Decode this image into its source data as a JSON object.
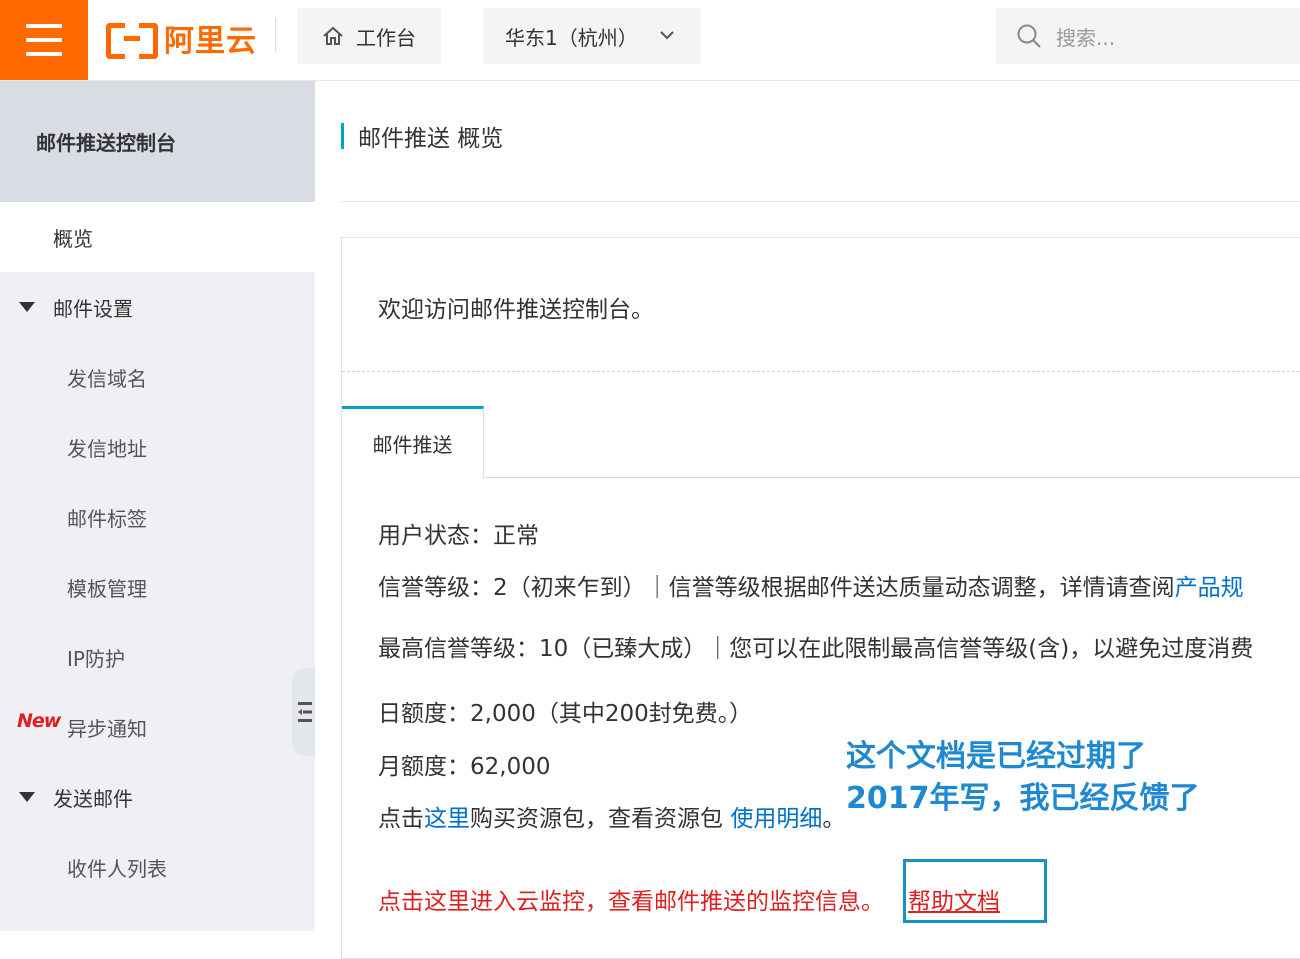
{
  "header": {
    "logo_text": "阿里云",
    "workbench_label": "工作台",
    "region_label": "华东1（杭州）",
    "search_placeholder": "搜索..."
  },
  "sidebar": {
    "title": "邮件推送控制台",
    "items": [
      {
        "label": "概览",
        "level": 1,
        "active": true
      },
      {
        "label": "邮件设置",
        "level": 1,
        "expanded": true
      },
      {
        "label": "发信域名",
        "level": 2
      },
      {
        "label": "发信地址",
        "level": 2
      },
      {
        "label": "邮件标签",
        "level": 2
      },
      {
        "label": "模板管理",
        "level": 2
      },
      {
        "label": "IP防护",
        "level": 2
      },
      {
        "label": "异步通知",
        "level": 2,
        "badge": "New"
      },
      {
        "label": "发送邮件",
        "level": 1,
        "expanded": true
      },
      {
        "label": "收件人列表",
        "level": 2
      }
    ]
  },
  "main": {
    "page_title": "邮件推送 概览",
    "welcome": "欢迎访问邮件推送控制台。",
    "tab_label": "邮件推送",
    "user_status": "用户状态：正常",
    "reputation": "信誉等级：2（初来乍到）｜信誉等级根据邮件送达质量动态调整，详情请查阅",
    "reputation_link": "产品规",
    "max_reputation": "最高信誉等级：10（已臻大成）｜您可以在此限制最高信誉等级(含)，以避免过度消费",
    "daily_quota": "日额度：2,000（其中200封免费。）",
    "monthly_quota": "月额度：62,000",
    "buy_prefix": "点击",
    "buy_link": "这里",
    "buy_middle": "购买资源包，查看资源包 ",
    "usage_link": "使用明细",
    "buy_suffix": "。",
    "monitor_text": "点击这里进入云监控，查看邮件推送的监控信息。",
    "help_link": "帮助文档"
  },
  "annotation": {
    "line1": "这个文档是已经过期了",
    "line2": "2017年写，我已经反馈了"
  },
  "colors": {
    "brand": "#ff6a00",
    "accent": "#00a2ca",
    "link": "#0070cc",
    "warning": "#e02020",
    "annotation": "#1e88d0"
  }
}
